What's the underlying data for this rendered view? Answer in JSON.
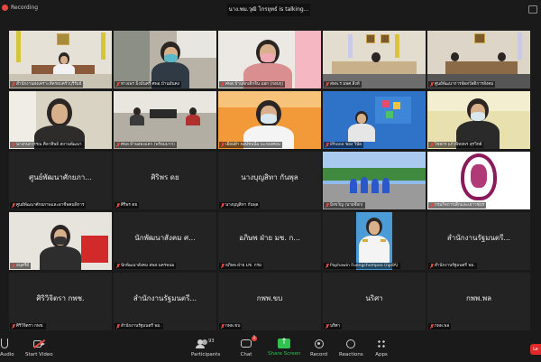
{
  "recording": {
    "label": "Recording"
  },
  "talking_banner": "นาง.พม.วุฒิ โกรยุทธ์ is talking...",
  "colors": {
    "record_red": "#e8473f",
    "share_green": "#31c250",
    "end_red": "#e02a2a",
    "tile_bg": "#232323",
    "app_bg": "#1a1a1a"
  },
  "tiles": [
    {
      "label": "สำนักงานสงเคราะห์ครอบครัวบุรีรัมย์",
      "name": "",
      "video": true
    },
    {
      "label": "ทางเพร มิ่งมั่นศรี ศพอ.บ้านมั่นคง",
      "name": "",
      "video": true
    },
    {
      "label": "ศพด.บ้านพักเด็กจิน แอก (กอบกุ)",
      "name": "",
      "video": true
    },
    {
      "label": "สพพ.ร มพศ.สิงห์",
      "name": "",
      "video": true
    },
    {
      "label": "ศูนย์พัฒนาการจัดสวัสดิการสังคม",
      "name": "",
      "video": true
    },
    {
      "label": "นางกนกวรรณ ศิลาทิพย์ สถานพัฒนา",
      "name": "",
      "video": true
    },
    {
      "label": "ศพอ.บ้านสองแคว (พร้อมมาก)",
      "name": "",
      "video": true
    },
    {
      "label": "เยี่ยมผ้า พงษ์ชนนี่ม มะกองศอน",
      "name": "",
      "video": true
    },
    {
      "label": "iPhone ของ วินัย",
      "name": "",
      "video": true
    },
    {
      "label": "ไชยกร แก้วพิทยพร สุรวิทย์",
      "name": "",
      "video": true
    },
    {
      "label": "ศูนย์พัฒนาศักยภาพและอาชีพคนพิการ",
      "name": "ศูนย์พัฒนาศักยภา...",
      "video": false
    },
    {
      "label": "ศิริพร ดย",
      "name": "ศิริพร ดย",
      "video": false
    },
    {
      "label": "นางบุญสิทา กันพุล",
      "name": "นางบุญสิทา กันพุล",
      "video": false
    },
    {
      "label": "มิ่งขวัญ (นายจ๊อก)",
      "name": "",
      "video": true
    },
    {
      "label": "กรมกิจการเด็กและเยาวชนร",
      "name": "",
      "video": true
    },
    {
      "label": "อนุศรีย์",
      "name": "",
      "video": true
    },
    {
      "label": "นักพัฒนาสังคม สพส.นครพนม",
      "name": "นักพัฒนาสังคม ศ...",
      "video": false
    },
    {
      "label": "อภิษพ ฝ่าย มช. กรม",
      "name": "อภิษพ ฝ่าย มช. ก...",
      "video": false
    },
    {
      "label": "Paphawin Fuengchompoo (npdA)",
      "name": "",
      "video": true
    },
    {
      "label": "สำนักงานรัฐมนตรี พม.",
      "name": "สำนักงานรัฐมนตรี...",
      "video": false
    },
    {
      "label": "ศิริวิจิตรา กพช.",
      "name": "ศิริวิจิตรา กพช.",
      "video": false
    },
    {
      "label": "สำนักงานรัฐมนตรี พม.",
      "name": "สำนักงานรัฐมนตรี...",
      "video": false
    },
    {
      "label": "กพพ.ขบ",
      "name": "กพพ.ขบ",
      "video": false
    },
    {
      "label": "นริศา",
      "name": "นริศา",
      "video": false
    },
    {
      "label": "กพพ.พล",
      "name": "กพพ.พล",
      "video": false
    }
  ],
  "toolbar": {
    "audio": "Audio",
    "stop_video": "Start Video",
    "participants": "Participants",
    "participants_count": "93",
    "chat": "Chat",
    "chat_badge": "1",
    "share": "Share Screen",
    "record": "Record",
    "reactions": "Reactions",
    "apps": "Apps",
    "leave": "Le"
  }
}
